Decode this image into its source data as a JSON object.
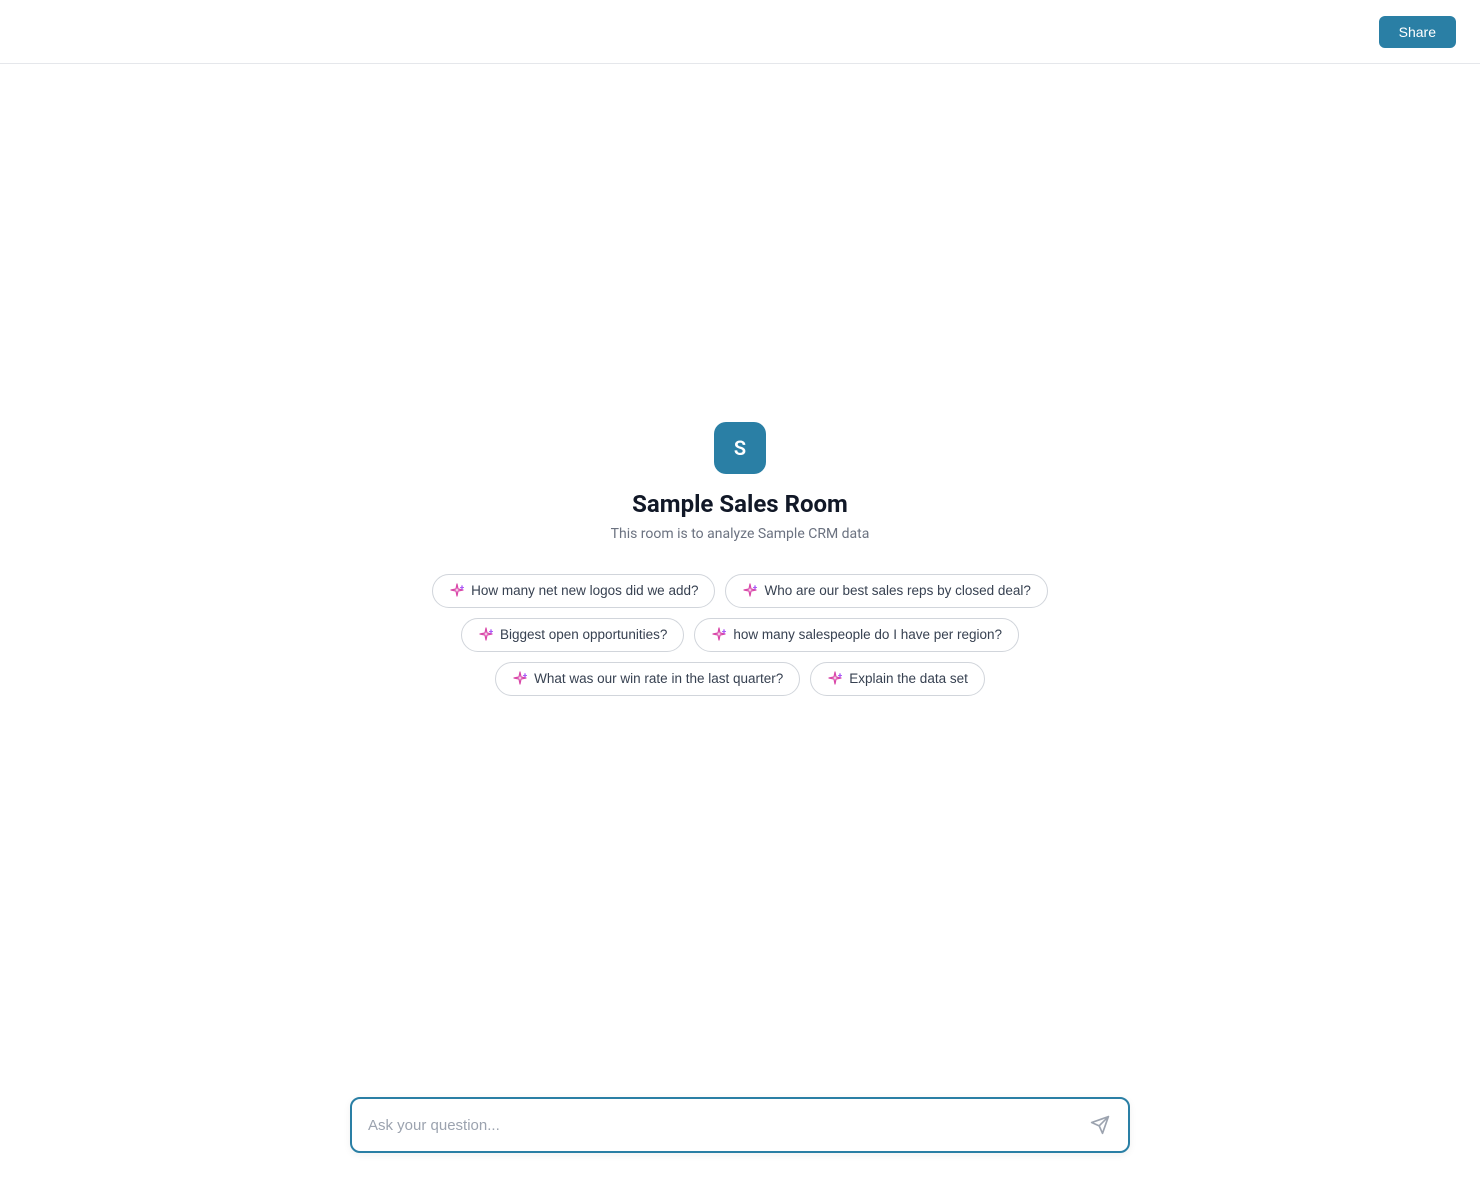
{
  "header": {
    "share_button_label": "Share"
  },
  "room": {
    "icon_letter": "S",
    "title": "Sample Sales Room",
    "subtitle": "This room is to analyze Sample CRM data"
  },
  "suggestions": {
    "rows": [
      [
        {
          "id": "chip-1",
          "label": "How many net new logos did we add?"
        },
        {
          "id": "chip-2",
          "label": "Who are our best sales reps by closed deal?"
        }
      ],
      [
        {
          "id": "chip-3",
          "label": "Biggest open opportunities?"
        },
        {
          "id": "chip-4",
          "label": "how many salespeople do I have per region?"
        }
      ],
      [
        {
          "id": "chip-5",
          "label": "What was our win rate in the last quarter?"
        },
        {
          "id": "chip-6",
          "label": "Explain the data set"
        }
      ]
    ]
  },
  "input": {
    "placeholder": "Ask your question..."
  }
}
